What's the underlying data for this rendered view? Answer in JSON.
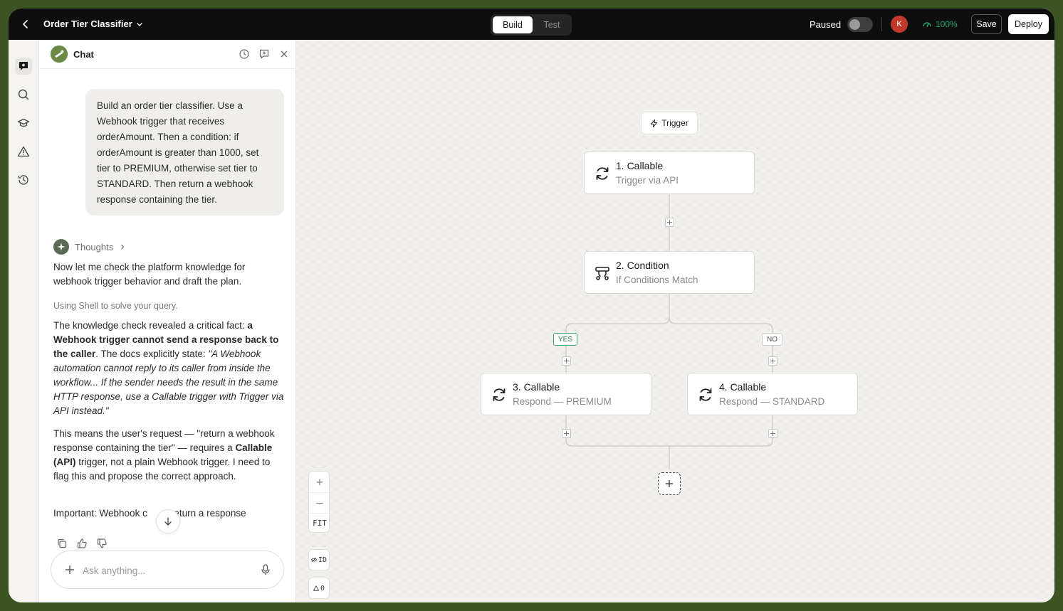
{
  "topbar": {
    "title": "Order Tier Classifier",
    "tabs": [
      {
        "label": "Build",
        "active": true
      },
      {
        "label": "Test",
        "active": false
      }
    ],
    "paused_label": "Paused",
    "avatar_initial": "K",
    "health": "100%",
    "save_label": "Save",
    "deploy_label": "Deploy"
  },
  "rail": {
    "items": [
      "chat-icon",
      "search-icon",
      "graduation-cap-icon",
      "warning-icon",
      "history-icon"
    ]
  },
  "chat": {
    "title": "Chat",
    "user_message": "Build an order tier classifier. Use a Webhook trigger that receives orderAmount. Then a condition: if orderAmount is greater than 1000, set tier to PREMIUM, otherwise set tier to STANDARD. Then return a webhook response containing the tier.",
    "thoughts_label": "Thoughts",
    "p1": "Now let me check the platform knowledge for webhook trigger behavior and draft the plan.",
    "status": "Using Shell to solve your query.",
    "p2": {
      "a": "The knowledge check revealed a critical fact: ",
      "b": "a Webhook trigger cannot send a response back to the caller",
      "c": ". The docs explicitly state: ",
      "d": "\"A Webhook automation cannot reply to its caller from inside the workflow... If the sender needs the result in the same HTTP response, use a Callable trigger with Trigger via API instead.\""
    },
    "p3": {
      "a": "This means the user's request — \"return a webhook response containing the tier\" — requires a ",
      "b": "Callable (API)",
      "c": " trigger, not a plain Webhook trigger. I need to flag this and propose the correct approach."
    },
    "p4": "Important: Webhook c          eturn a response",
    "composer_placeholder": "Ask anything..."
  },
  "canvas": {
    "trigger_label": "Trigger",
    "nodes": [
      {
        "title": "1. Callable",
        "subtitle": "Trigger via API",
        "icon": "refresh-icon"
      },
      {
        "title": "2. Condition",
        "subtitle": "If Conditions Match",
        "icon": "branch-icon"
      },
      {
        "title": "3. Callable",
        "subtitle": "Respond — PREMIUM",
        "icon": "refresh-icon"
      },
      {
        "title": "4. Callable",
        "subtitle": "Respond — STANDARD",
        "icon": "refresh-icon"
      }
    ],
    "branch_yes": "YES",
    "branch_no": "NO",
    "zoom_in": "+",
    "zoom_out": "–",
    "fit_label": "FIT",
    "id_label": "ID",
    "warnings_count": "0"
  },
  "colors": {
    "accent_green": "#1ea96c",
    "avatar": "#c0392b",
    "frame_bg": "#3c5424"
  }
}
